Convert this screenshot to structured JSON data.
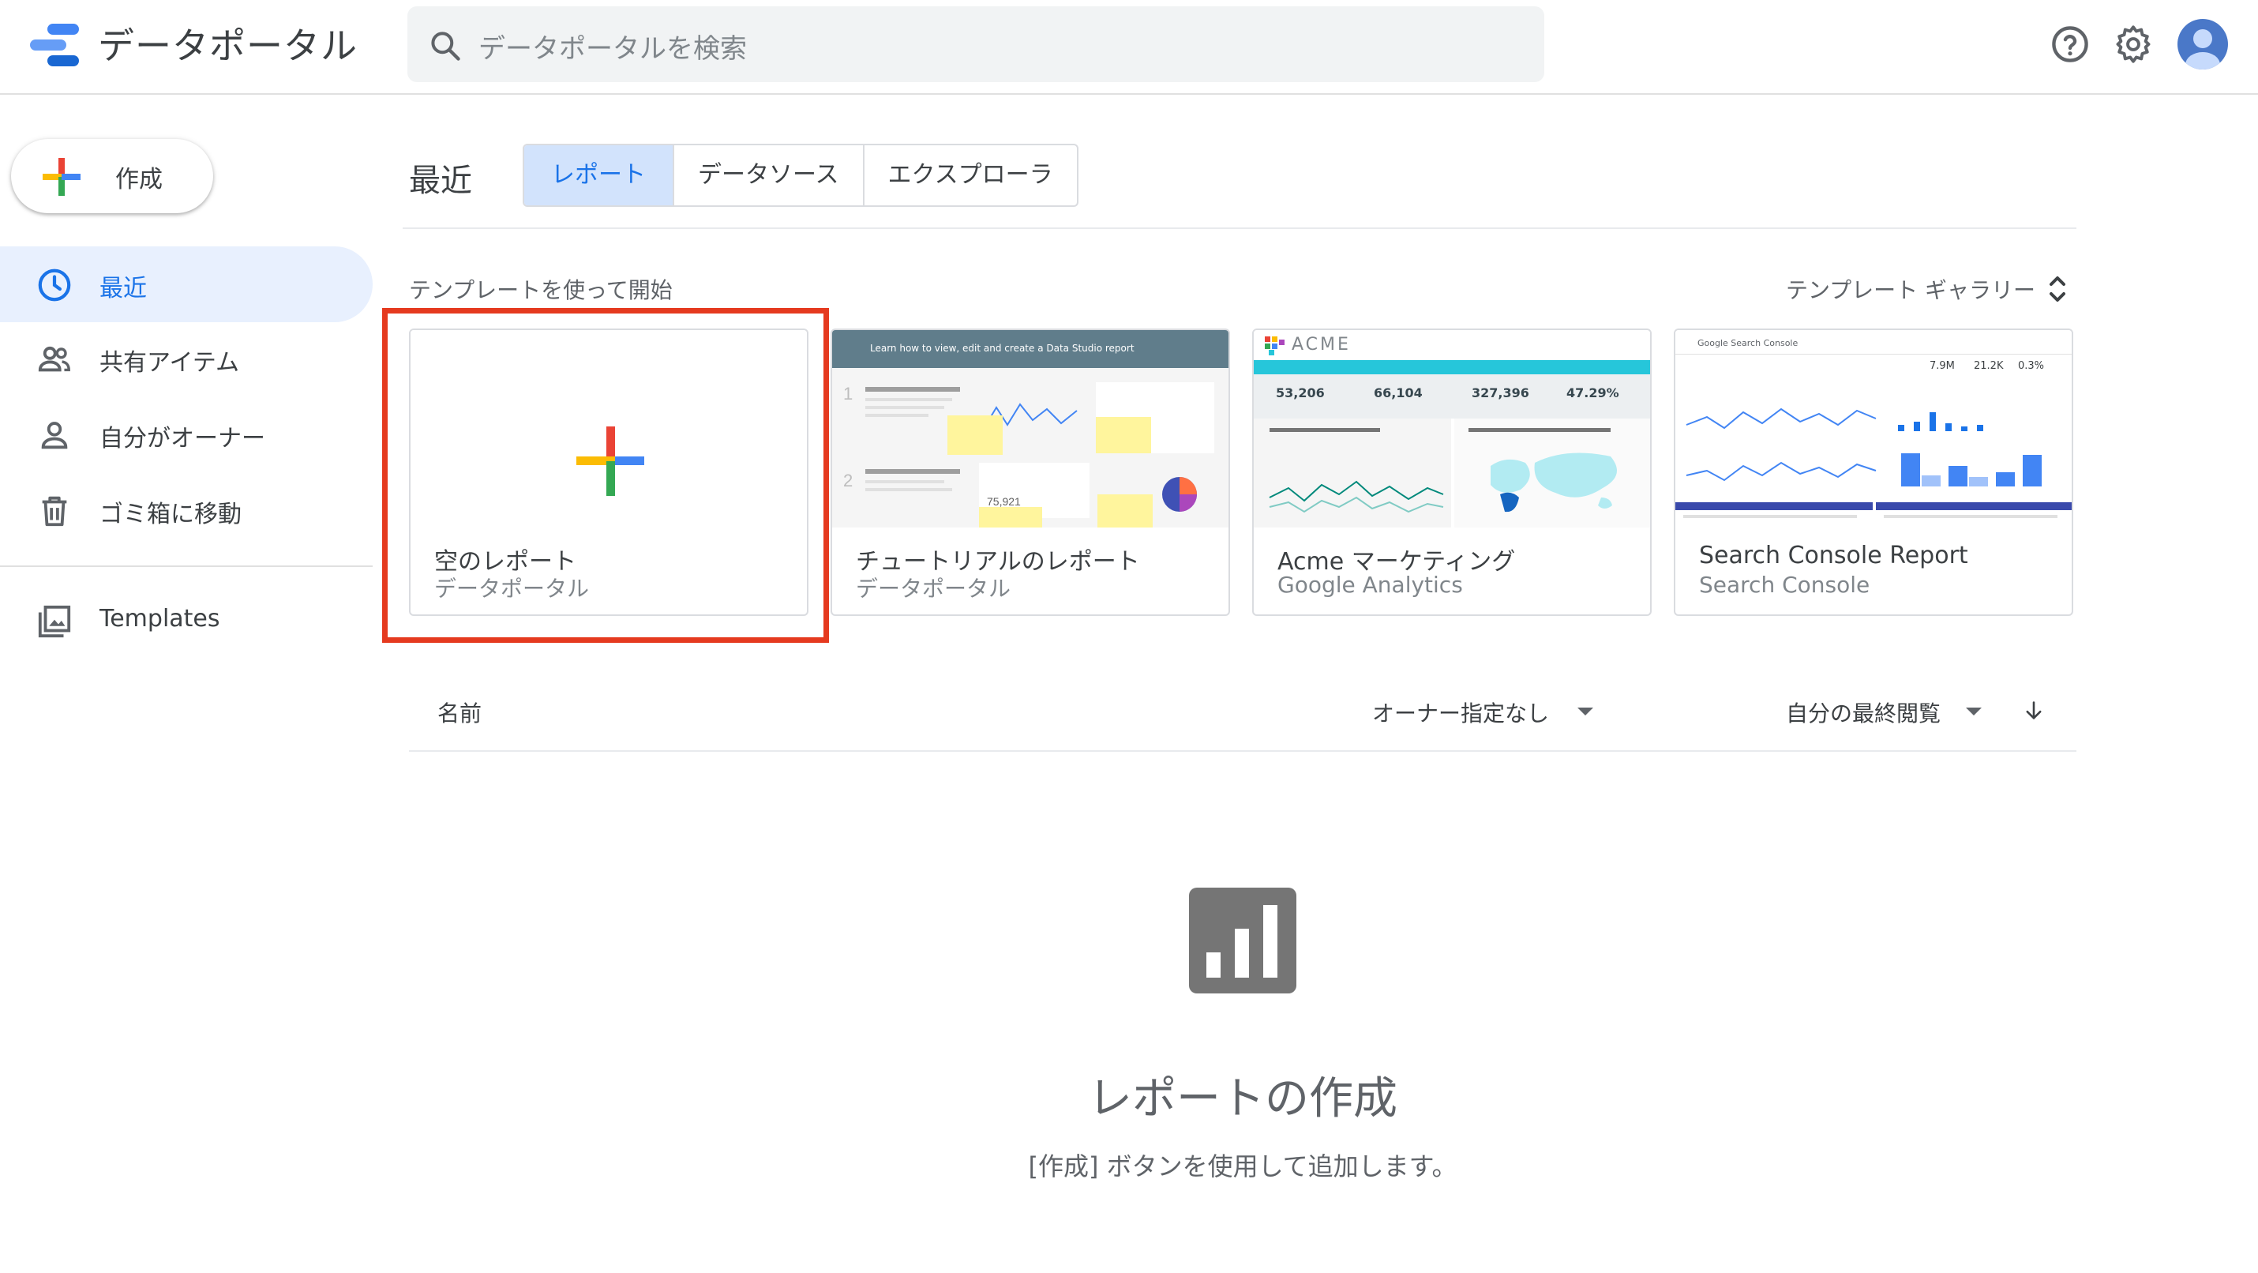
{
  "header": {
    "app_title": "データポータル",
    "search_placeholder": "データポータルを検索"
  },
  "sidebar": {
    "create_label": "作成",
    "items": [
      {
        "label": "最近",
        "icon": "clock-icon",
        "active": true
      },
      {
        "label": "共有アイテム",
        "icon": "people-icon",
        "active": false
      },
      {
        "label": "自分がオーナー",
        "icon": "person-icon",
        "active": false
      },
      {
        "label": "ゴミ箱に移動",
        "icon": "trash-icon",
        "active": false
      },
      {
        "label": "Templates",
        "icon": "image-gallery-icon",
        "active": false
      }
    ]
  },
  "main": {
    "title": "最近",
    "tabs": [
      {
        "label": "レポート",
        "active": true
      },
      {
        "label": "データソース",
        "active": false
      },
      {
        "label": "エクスプローラ",
        "active": false
      }
    ],
    "templates_label": "テンプレートを使って開始",
    "gallery_label": "テンプレート ギャラリー",
    "templates": [
      {
        "title": "空のレポート",
        "subtitle": "データポータル"
      },
      {
        "title": "チュートリアルのレポート",
        "subtitle": "データポータル",
        "thumb_header": "Learn how to view, edit and create a Data Studio report"
      },
      {
        "title": "Acme マーケティング",
        "subtitle": "Google Analytics",
        "thumb_brand": "ACME",
        "metrics": [
          "53,206",
          "66,104",
          "327,396",
          "47.29%"
        ]
      },
      {
        "title": "Search Console Report",
        "subtitle": "Search Console",
        "thumb_brand": "Google Search Console",
        "metrics": [
          "7.9M",
          "21.2K",
          "0.3%"
        ]
      }
    ],
    "list": {
      "name_col": "名前",
      "owner_filter": "オーナー指定なし",
      "sort_label": "自分の最終閲覧"
    },
    "empty": {
      "title": "レポートの作成",
      "subtitle": "[作成] ボタンを使用して追加します。"
    }
  },
  "colors": {
    "accent": "#1a73e8",
    "highlight_border": "#e53a1f",
    "active_nav_bg": "#e8f0fe",
    "google_red": "#ea4335",
    "google_yellow": "#fbbc04",
    "google_green": "#34a853",
    "google_blue": "#4285f4"
  }
}
